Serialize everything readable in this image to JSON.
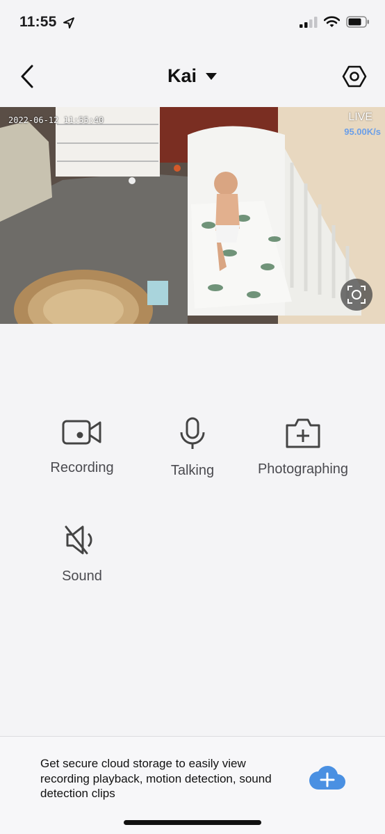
{
  "status_bar": {
    "time": "11:55",
    "icons": [
      "location-arrow-icon",
      "cellular-signal-icon",
      "wifi-icon",
      "battery-icon"
    ]
  },
  "nav": {
    "title": "Kai",
    "back_icon": "chevron-left-icon",
    "dropdown_icon": "caret-down-icon",
    "settings_icon": "hexagon-gear-icon"
  },
  "video": {
    "timestamp": "2022-06-12 11:55:40",
    "live_label": "LIVE",
    "bitrate": "95.00K/s",
    "screenshot_icon": "screenshot-capture-icon"
  },
  "controls": [
    {
      "label": "Recording",
      "icon": "video-camera-icon"
    },
    {
      "label": "Talking",
      "icon": "microphone-icon"
    },
    {
      "label": "Photographing",
      "icon": "camera-plus-icon"
    },
    {
      "label": "Sound",
      "icon": "speaker-muted-icon"
    }
  ],
  "banner": {
    "text": "Get secure cloud storage to easily view recording playback, motion detection, sound detection clips",
    "icon": "cloud-plus-icon",
    "accent_color": "#4a90e2"
  }
}
